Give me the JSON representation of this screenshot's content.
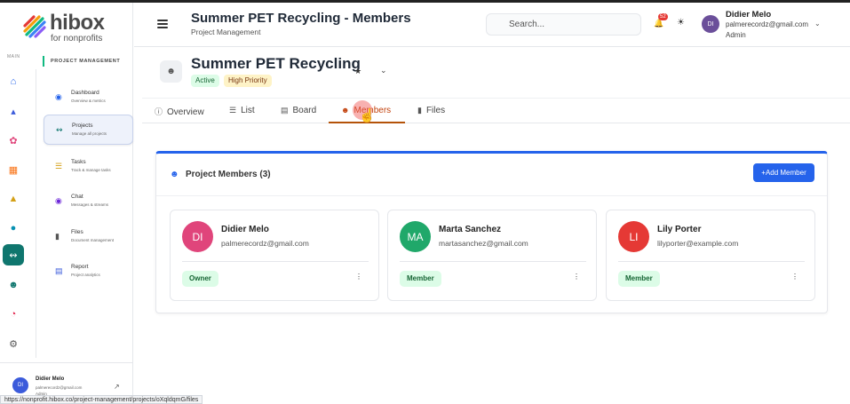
{
  "brand": {
    "name": "hibox",
    "tagline": "for nonprofits"
  },
  "rail": {
    "main_label": "MAIN"
  },
  "sidebar": {
    "section_title": "PROJECT MANAGEMENT",
    "items": [
      {
        "title": "Dashboard",
        "subtitle": "Overview & metrics"
      },
      {
        "title": "Projects",
        "subtitle": "Manage all projects"
      },
      {
        "title": "Tasks",
        "subtitle": "Track & manage tasks"
      },
      {
        "title": "Chat",
        "subtitle": "Messages & streams"
      },
      {
        "title": "Files",
        "subtitle": "Document management"
      },
      {
        "title": "Report",
        "subtitle": "Project analytics"
      }
    ],
    "user": {
      "initials": "DI",
      "name": "Didier Melo",
      "email": "palmerecordz@gmail.com",
      "role": "Admin"
    }
  },
  "header": {
    "title": "Summer PET Recycling - Members",
    "subtitle": "Project Management",
    "search_placeholder": "Search...",
    "notification_count": "52",
    "user": {
      "initials": "DI",
      "name": "Didier Melo",
      "email": "palmerecordz@gmail.com",
      "role": "Admin"
    }
  },
  "project": {
    "title": "Summer PET Recycling",
    "status": "Active",
    "priority": "High Priority"
  },
  "tabs": [
    {
      "label": "Overview"
    },
    {
      "label": "List"
    },
    {
      "label": "Board"
    },
    {
      "label": "Members",
      "active": true
    },
    {
      "label": "Files"
    }
  ],
  "members_card": {
    "title": "Project Members (3)",
    "add_button": "+Add Member",
    "members": [
      {
        "initials": "DI",
        "name": "Didier Melo",
        "email": "palmerecordz@gmail.com",
        "role": "Owner",
        "color": "#e0457b"
      },
      {
        "initials": "MA",
        "name": "Marta Sanchez",
        "email": "martasanchez@gmail.com",
        "role": "Member",
        "color": "#20a86a"
      },
      {
        "initials": "LI",
        "name": "Lily Porter",
        "email": "lilyporter@example.com",
        "role": "Member",
        "color": "#e53935"
      }
    ]
  },
  "status_url": "https://nonprofit.hibox.co/project-management/projects/oXqldqmG/files",
  "colors": {
    "accent": "#2563eb",
    "active_tab": "#c2410c",
    "rail_active": "#0f766e"
  }
}
